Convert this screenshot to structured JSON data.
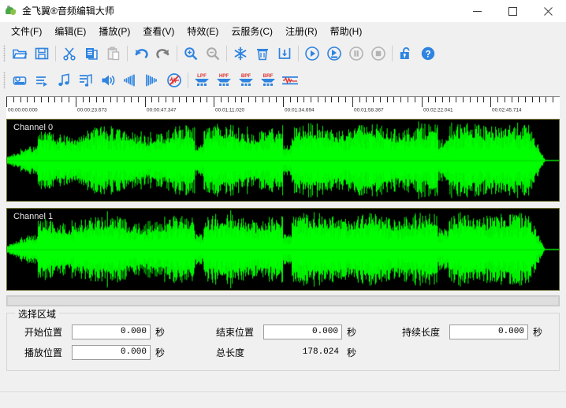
{
  "window": {
    "title": "金飞翼®音频编辑大师",
    "app_icon": "leaf-app-icon",
    "controls": [
      {
        "name": "minimize-button",
        "glyph": "minimize-icon"
      },
      {
        "name": "maximize-button",
        "glyph": "maximize-icon"
      },
      {
        "name": "close-button",
        "glyph": "close-icon"
      }
    ]
  },
  "menubar": {
    "items": [
      {
        "label": "文件(F)",
        "name": "menu-file"
      },
      {
        "label": "编辑(E)",
        "name": "menu-edit"
      },
      {
        "label": "播放(P)",
        "name": "menu-play"
      },
      {
        "label": "查看(V)",
        "name": "menu-view"
      },
      {
        "label": "特效(E)",
        "name": "menu-effects"
      },
      {
        "label": "云服务(C)",
        "name": "menu-cloud"
      },
      {
        "label": "注册(R)",
        "name": "menu-register"
      },
      {
        "label": "帮助(H)",
        "name": "menu-help"
      }
    ]
  },
  "toolbar_row1": {
    "buttons": [
      {
        "icon": "open-folder-icon",
        "enabled": true
      },
      {
        "icon": "save-icon",
        "enabled": true
      },
      {
        "sep": true
      },
      {
        "icon": "cut-scissors-icon",
        "enabled": true
      },
      {
        "icon": "copy-icon",
        "enabled": true
      },
      {
        "icon": "paste-icon",
        "enabled": false
      },
      {
        "sep": true
      },
      {
        "icon": "undo-arrow-icon",
        "enabled": true
      },
      {
        "icon": "redo-arrow-icon",
        "enabled": true
      },
      {
        "sep": true
      },
      {
        "icon": "zoom-in-icon",
        "enabled": true
      },
      {
        "icon": "zoom-out-icon",
        "enabled": false
      },
      {
        "sep": true
      },
      {
        "icon": "mix-snowflake-icon",
        "enabled": true
      },
      {
        "icon": "delete-trash-icon",
        "enabled": true
      },
      {
        "icon": "insert-file-icon",
        "enabled": true
      },
      {
        "sep": true
      },
      {
        "icon": "play-icon",
        "enabled": true
      },
      {
        "icon": "play-selection-icon",
        "enabled": true
      },
      {
        "icon": "pause-icon",
        "enabled": false
      },
      {
        "icon": "stop-icon",
        "enabled": false
      },
      {
        "sep": true
      },
      {
        "icon": "unlock-padlock-icon",
        "enabled": true
      },
      {
        "icon": "help-question-icon",
        "enabled": true
      }
    ]
  },
  "toolbar_row2": {
    "buttons": [
      {
        "icon": "record-icon",
        "enabled": true,
        "label": ""
      },
      {
        "icon": "convert-format-icon",
        "enabled": true,
        "label": ""
      },
      {
        "icon": "music-note-icon",
        "enabled": true,
        "label": ""
      },
      {
        "icon": "playlist-note-icon",
        "enabled": true,
        "label": ""
      },
      {
        "icon": "volume-speaker-icon",
        "enabled": true,
        "label": ""
      },
      {
        "icon": "fade-in-icon",
        "enabled": true,
        "label": ""
      },
      {
        "icon": "fade-out-icon",
        "enabled": true,
        "label": ""
      },
      {
        "icon": "noise-reduction-icon",
        "enabled": true,
        "label": ""
      },
      {
        "sep": true
      },
      {
        "icon": "lowpass-filter-icon",
        "enabled": true,
        "label": "LPF"
      },
      {
        "icon": "highpass-filter-icon",
        "enabled": true,
        "label": "HPF"
      },
      {
        "icon": "bandpass-filter-icon",
        "enabled": true,
        "label": "BPF"
      },
      {
        "icon": "bandreject-filter-icon",
        "enabled": true,
        "label": "BRF"
      },
      {
        "icon": "equalizer-icon",
        "enabled": true,
        "label": ""
      }
    ]
  },
  "ruler": {
    "labels": [
      "00:00:00.000",
      "00:00:23.673",
      "00:00:47.347",
      "00:01:11.020",
      "00:01:34.694",
      "00:01:58.367",
      "00:02:22.041",
      "00:02:45.714"
    ]
  },
  "tracks": [
    {
      "label": "Channel 0",
      "name": "waveform-channel-0",
      "color": "#00ee00"
    },
    {
      "label": "Channel 1",
      "name": "waveform-channel-1",
      "color": "#00ee00"
    }
  ],
  "selection_group": {
    "title": "选择区域",
    "fields": {
      "start_label": "开始位置",
      "start_value": "0.000",
      "start_unit": "秒",
      "end_label": "结束位置",
      "end_value": "0.000",
      "end_unit": "秒",
      "duration_label": "持续长度",
      "duration_value": "0.000",
      "duration_unit": "秒",
      "play_pos_label": "播放位置",
      "play_pos_value": "0.000",
      "play_pos_unit": "秒",
      "total_label": "总长度",
      "total_value": "178.024",
      "total_unit": "秒"
    }
  }
}
